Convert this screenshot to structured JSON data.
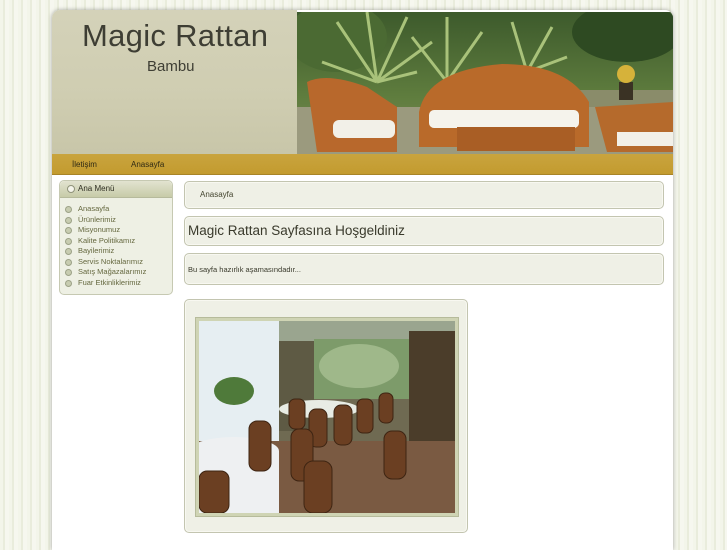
{
  "header": {
    "site_title": "Magic Rattan",
    "site_subtitle": "Bambu"
  },
  "nav": [
    {
      "label": "İletişim"
    },
    {
      "label": "Anasayfa"
    }
  ],
  "sidebar": {
    "heading": "Ana Menü",
    "items": [
      {
        "label": "Anasayfa"
      },
      {
        "label": "Ürünlerimiz"
      },
      {
        "label": "Misyonumuz"
      },
      {
        "label": "Kalite Politikamız"
      },
      {
        "label": "Bayilerimiz"
      },
      {
        "label": "Servis Noktalarımız"
      },
      {
        "label": "Satış Mağazalarımız"
      },
      {
        "label": "Fuar Etkinliklerimiz"
      }
    ]
  },
  "main": {
    "breadcrumb": "Anasayfa",
    "title": "Magic Rattan Sayfasına Hoşgeldiniz",
    "notice": "Bu sayfa hazırlık aşamasındadır..."
  },
  "colors": {
    "navbar": "#c39b2f",
    "panel_bg": "#eff0e6",
    "menu_link": "#65683f",
    "logo_bg": "#d4d2b9"
  }
}
